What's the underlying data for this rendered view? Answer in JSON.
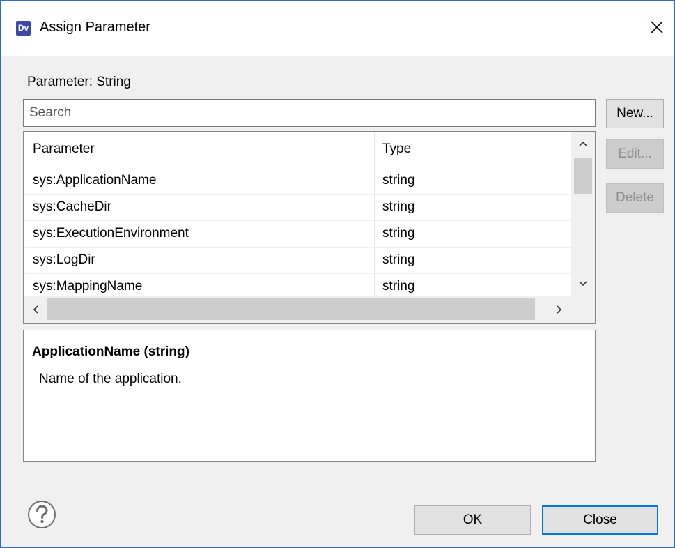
{
  "window": {
    "icon_text": "Dv",
    "title": "Assign Parameter"
  },
  "parameter_label": "Parameter: String",
  "search": {
    "placeholder": "Search",
    "value": ""
  },
  "side_buttons": {
    "new": "New...",
    "edit": "Edit...",
    "delete": "Delete"
  },
  "table": {
    "columns": [
      "Parameter",
      "Type"
    ],
    "rows": [
      {
        "parameter": "sys:ApplicationName",
        "type": "string"
      },
      {
        "parameter": "sys:CacheDir",
        "type": "string"
      },
      {
        "parameter": "sys:ExecutionEnvironment",
        "type": "string"
      },
      {
        "parameter": "sys:LogDir",
        "type": "string"
      },
      {
        "parameter": "sys:MappingName",
        "type": "string"
      }
    ]
  },
  "description": {
    "title": "ApplicationName (string)",
    "body": "Name of the application."
  },
  "footer": {
    "ok": "OK",
    "close": "Close"
  },
  "colors": {
    "accent": "#0078d7",
    "border": "#2a6fb8"
  }
}
